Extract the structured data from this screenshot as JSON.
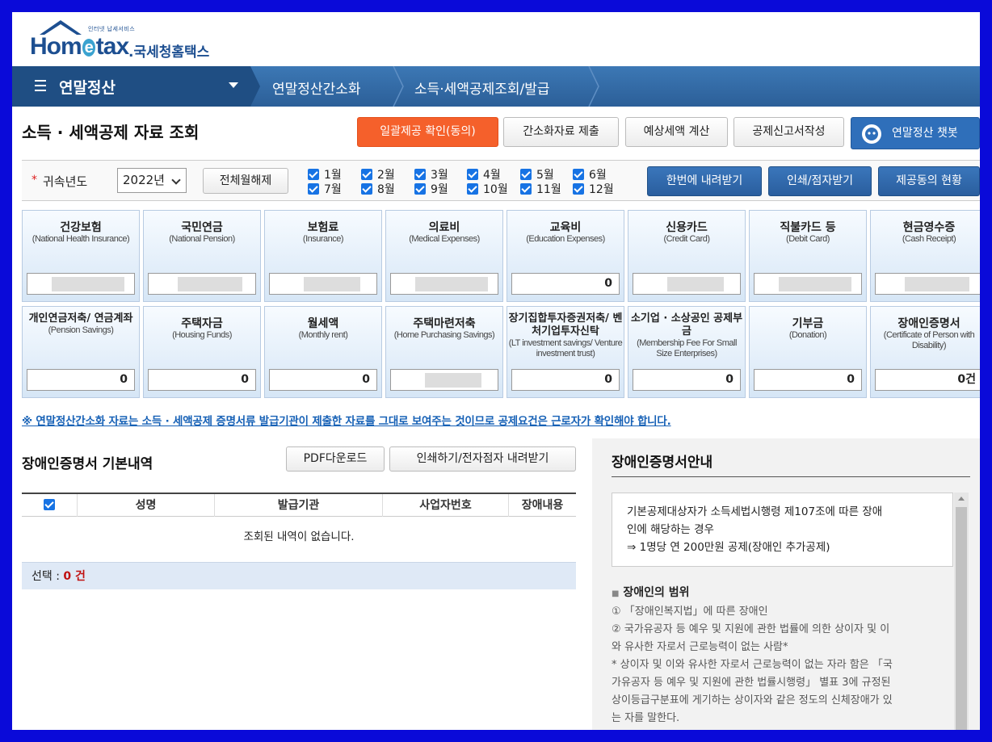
{
  "brand": {
    "small_text": "인터넷 납세서비스",
    "logo_pre": "Hom",
    "logo_e": "e",
    "logo_post": "tax",
    "logo_kr": ".국세청홈택스"
  },
  "nav": {
    "menu": "연말정산",
    "items": [
      "연말정산간소화",
      "소득·세액공제조회/발급"
    ]
  },
  "page": {
    "title": "소득 · 세액공제 자료 조회"
  },
  "actions": {
    "bulk_consent": "일괄제공 확인(동의)",
    "submit": "간소화자료 제출",
    "estimate": "예상세액 계산",
    "deduction_form": "공제신고서작성",
    "chatbot": "연말정산 챗봇"
  },
  "filter": {
    "label": "귀속년도",
    "year": "2022년",
    "clear_all": "전체월해제",
    "months": [
      "1월",
      "2월",
      "3월",
      "4월",
      "5월",
      "6월",
      "7월",
      "8월",
      "9월",
      "10월",
      "11월",
      "12월"
    ],
    "download_all": "한번에 내려받기",
    "print": "인쇄/점자받기",
    "consent_status": "제공동의 현황"
  },
  "cards": [
    {
      "title": "건강보험",
      "sub": "(National Health Insurance)",
      "value": ""
    },
    {
      "title": "국민연금",
      "sub": "(National Pension)",
      "value": ""
    },
    {
      "title": "보험료",
      "sub": "(Insurance)",
      "value": ""
    },
    {
      "title": "의료비",
      "sub": "(Medical Expenses)",
      "value": ""
    },
    {
      "title": "교육비",
      "sub": "(Education Expenses)",
      "value": "0"
    },
    {
      "title": "신용카드",
      "sub": "(Credit Card)",
      "value": ""
    },
    {
      "title": "직불카드 등",
      "sub": "(Debit Card)",
      "value": ""
    },
    {
      "title": "현금영수증",
      "sub": "(Cash Receipt)",
      "value": ""
    },
    {
      "title": "개인연금저축/ 연금계좌",
      "sub": "(Pension Savings)",
      "value": "0"
    },
    {
      "title": "주택자금",
      "sub": "(Housing Funds)",
      "value": "0"
    },
    {
      "title": "월세액",
      "sub": "(Monthly rent)",
      "value": "0"
    },
    {
      "title": "주택마련저축",
      "sub": "(Home Purchasing Savings)",
      "value": ""
    },
    {
      "title": "장기집합투자증권저축/ 벤처기업투자신탁",
      "sub": "(LT investment savings/ Venture investment trust)",
      "value": "0"
    },
    {
      "title": "소기업 · 소상공인 공제부금",
      "sub": "(Membership Fee For Small Size Enterprises)",
      "value": "0"
    },
    {
      "title": "기부금",
      "sub": "(Donation)",
      "value": "0"
    },
    {
      "title": "장애인증명서",
      "sub": "(Certificate of Person with Disability)",
      "value": "0건"
    }
  ],
  "notice": "※ 연말정산간소화 자료는 소득 · 세액공제 증명서류 발급기관이 제출한 자료를 그대로 보여주는 것이므로 공제요건은 근로자가 확인해야 합니다.",
  "left": {
    "title": "장애인증명서 기본내역",
    "pdf": "PDF다운로드",
    "print": "인쇄하기/전자점자 내려받기",
    "columns": [
      "성명",
      "발급기관",
      "사업자번호",
      "장애내용"
    ],
    "empty": "조회된 내역이 없습니다.",
    "selected_label": "선택 :",
    "selected_count": "0 건"
  },
  "right": {
    "title": "장애인증명서안내",
    "box_lines": [
      "기본공제대상자가 소득세법시행령 제107조에 따른 장애",
      "인에 해당하는 경우",
      "⇒ 1명당 연 200만원 공제(장애인 추가공제)"
    ],
    "section_title": "장애인의 범위",
    "section_lines": [
      "① 「장애인복지법」에 따른 장애인",
      "② 국가유공자 등 예우 및 지원에 관한 법률에 의한 상이자 및 이",
      "와 유사한 자로서 근로능력이 없는 사람*",
      "* 상이자 및 이와 유사한 자로서 근로능력이 없는 자라 함은 「국",
      "가유공자 등 예우 및 지원에 관한 법률시행령」 별표 3에 규정된",
      "상이등급구분표에 게기하는 상이자와 같은 정도의 신체장애가 있",
      "는 자를 말한다."
    ]
  }
}
